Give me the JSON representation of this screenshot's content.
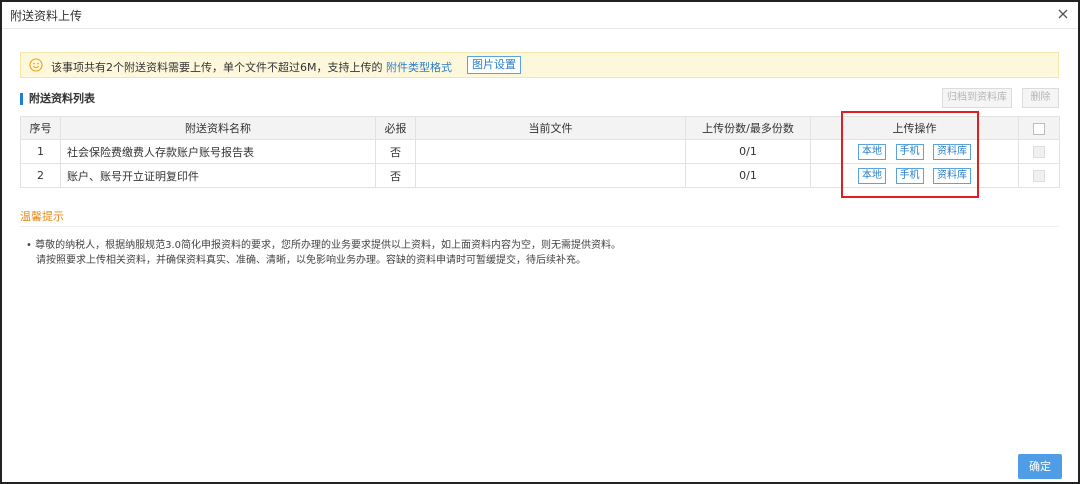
{
  "dialog": {
    "title": "附送资料上传",
    "close_icon": "close-icon"
  },
  "notice": {
    "icon": "smile-icon",
    "text": "该事项共有2个附送资料需要上传，单个文件不超过6M，支持上传的",
    "link": "附件类型格式",
    "button": "图片设置"
  },
  "section": {
    "title": "附送资料列表",
    "archive_button": "归档到资料库",
    "delete_button": "删除"
  },
  "table": {
    "headers": {
      "index": "序号",
      "name": "附送资料名称",
      "required": "必报",
      "current_file": "当前文件",
      "count": "上传份数/最多份数",
      "ops": "上传操作"
    },
    "rows": [
      {
        "index": "1",
        "name": "社会保险费缴费人存款账户账号报告表",
        "required": "否",
        "current_file": "",
        "count": "0/1",
        "ops": [
          "本地",
          "手机",
          "资料库"
        ]
      },
      {
        "index": "2",
        "name": "账户、账号开立证明复印件",
        "required": "否",
        "current_file": "",
        "count": "0/1",
        "ops": [
          "本地",
          "手机",
          "资料库"
        ]
      }
    ]
  },
  "tips": {
    "title": "温馨提示",
    "line1": "• 尊敬的纳税人，根据纳服规范3.0简化申报资料的要求，您所办理的业务要求提供以上资料，如上面资料内容为空，则无需提供资料。",
    "line2": "请按照要求上传相关资料，并确保资料真实、准确、清晰，以免影响业务办理。容缺的资料申请时可暂缓提交，待后续补充。"
  },
  "footer": {
    "confirm": "确定"
  },
  "colors": {
    "accent": "#1f7fd8",
    "highlight": "#e02020",
    "tips": "#e88a1a",
    "notice_bg": "#fdf8dc"
  }
}
